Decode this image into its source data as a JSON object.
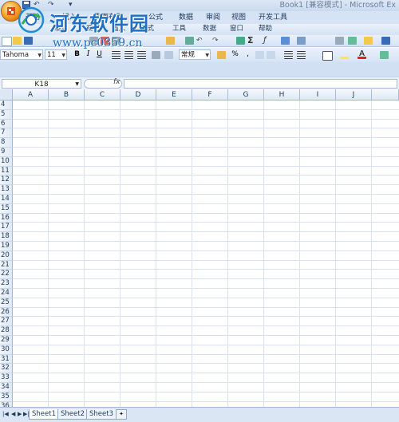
{
  "window": {
    "title": "Book1  [兼容模式] - Microsoft Ex",
    "quick_access": [
      "↶",
      "↷",
      "▾"
    ]
  },
  "watermark": {
    "line1": "河东软件园",
    "line2": "www.pc0359.cn"
  },
  "ribbon_tabs": [
    "开始",
    "插入",
    "页面布局",
    "公式",
    "数据",
    "审阅",
    "视图",
    "开发工具"
  ],
  "menu_row": [
    "编辑",
    "视图",
    "插入",
    "格式",
    "工具",
    "数据",
    "窗口",
    "帮助"
  ],
  "format": {
    "font": "Tahoma",
    "size": "11",
    "bold": "B",
    "italic": "I",
    "underline": "U",
    "number_format": "常规",
    "percent": "%",
    "comma": ","
  },
  "name_box": "K18",
  "fx_label": "fx",
  "formula_value": "",
  "columns": [
    "A",
    "B",
    "C",
    "D",
    "E",
    "F",
    "G",
    "H",
    "I",
    "J"
  ],
  "rows": [
    "4",
    "5",
    "6",
    "7",
    "8",
    "9",
    "10",
    "11",
    "12",
    "13",
    "14",
    "15",
    "16",
    "17",
    "18",
    "19",
    "20",
    "21",
    "22",
    "23",
    "24",
    "25",
    "26",
    "27",
    "28",
    "29",
    "30",
    "31",
    "32",
    "33",
    "34",
    "35",
    "36"
  ],
  "sheets": [
    "Sheet1",
    "Sheet2",
    "Sheet3"
  ],
  "active_sheet": "Sheet1",
  "colors": {
    "office_orange": "#f39a1e",
    "ribbon_blue": "#d6e3f4",
    "grid_line": "#d7e1ef",
    "watermark_blue": "#1f6fc4"
  },
  "icons": [
    "office-button",
    "save-icon",
    "undo-icon",
    "redo-icon",
    "sum-icon",
    "function-icon",
    "sort-icon",
    "chart-icon",
    "fill-color-icon",
    "font-color-icon"
  ]
}
